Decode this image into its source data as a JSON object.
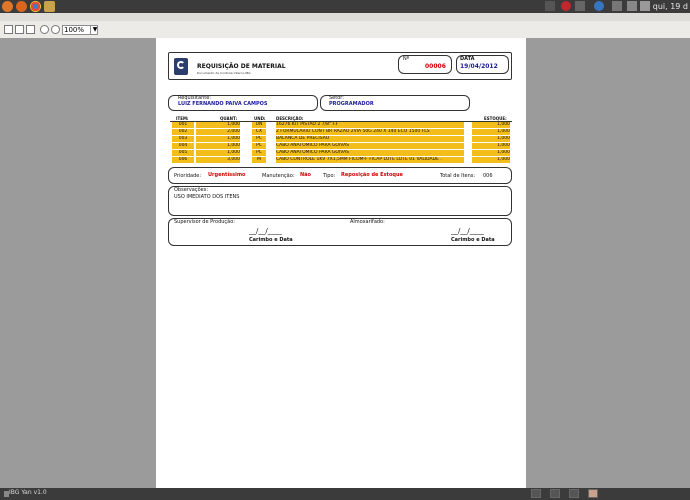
{
  "top_panel": {
    "clock": "qui, 19 d"
  },
  "toolbar": {
    "zoom": "100%"
  },
  "document": {
    "title": "REQUISIÇÃO DE MATERIAL",
    "subtitle": "Documento de Controle Interno IBG",
    "number_label": "Nº",
    "number": "00006",
    "date_label": "DATA",
    "date": "19/04/2012",
    "requester_label": "Requisitante:",
    "requester": "LUIZ FERNANDO PAIVA CAMPOS",
    "sector_label": "Setor:",
    "sector": "PROGRAMADOR",
    "columns": [
      "ITEM:",
      "QUANT:",
      "UND:",
      "DESCRIÇÃO:",
      "ESTOQUE:"
    ],
    "items": [
      {
        "item": "001",
        "qty": "1,000",
        "unit": "UN",
        "desc": "16276 KIT PISTÃO 2 7/8\" F.F",
        "stock": "1,000"
      },
      {
        "item": "002",
        "qty": "2,000",
        "unit": "CX",
        "desc": "2 FORMULARIO CONT BR RAZÃO 2VIA 50G 240 X 140 ECO 1500 FLS",
        "stock": "1,000"
      },
      {
        "item": "003",
        "qty": "1,000",
        "unit": "PC",
        "desc": "BALANCA DE PRECISÃO",
        "stock": "1,000"
      },
      {
        "item": "004",
        "qty": "1,000",
        "unit": "PC",
        "desc": "CABO ANATOMICO PARA GOIVAS",
        "stock": "1,000"
      },
      {
        "item": "005",
        "qty": "1,000",
        "unit": "PC",
        "desc": "CABO ANATOMICO PARA GOIVAS",
        "stock": "1,000"
      },
      {
        "item": "006",
        "qty": "3,000",
        "unit": "M",
        "desc": "CABO CONTROLE 1KV 7X1,5MM FICOM-F FICAP LOTE LOTE 01 VALIDADE .",
        "stock": "1,000"
      }
    ],
    "priority_label": "Prioridade:",
    "priority": "Urgentíssimo",
    "maintenance_label": "Manutenção:",
    "maintenance": "Não",
    "type_label": "Tipo:",
    "type": "Reposição de Estoque",
    "total_label": "Total de Itens:",
    "total": "006",
    "notes_label": "Observações:",
    "notes": "USO IMEDIATO DOS ITENS",
    "supervisor_label": "Supervisor de Produção:",
    "warehouse_label": "Almoxarifado:",
    "date_line": "__/__/____",
    "stamp_label": "Carimbo e Data"
  },
  "taskbar": {
    "app": "IBG Yan v1.0"
  }
}
